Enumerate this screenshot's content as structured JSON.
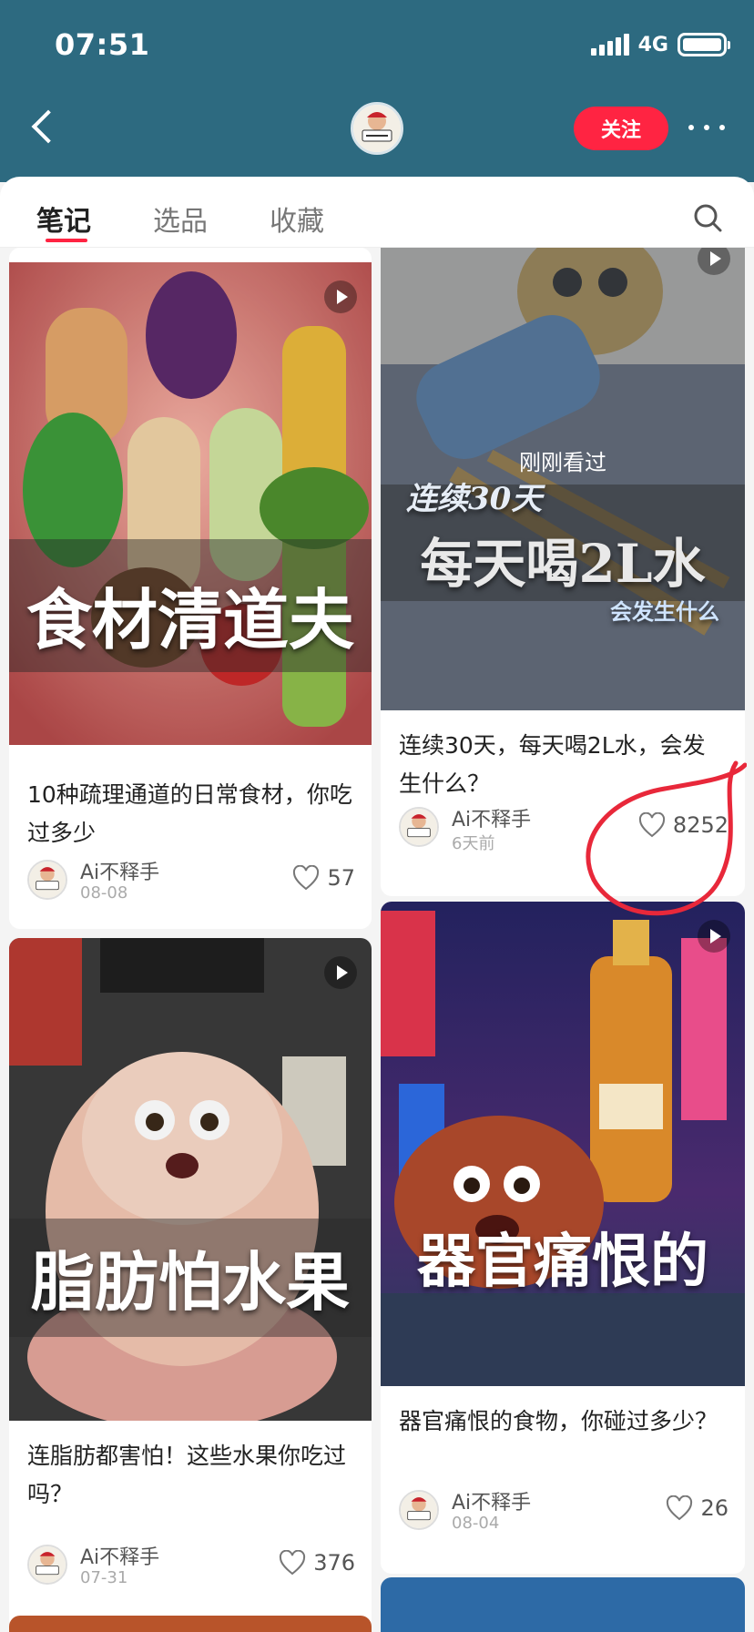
{
  "status": {
    "time": "07:51",
    "network": "4G"
  },
  "header": {
    "follow_label": "关注"
  },
  "tabs": [
    {
      "label": "笔记",
      "active": true
    },
    {
      "label": "选品",
      "active": false
    },
    {
      "label": "收藏",
      "active": false
    }
  ],
  "notes": [
    {
      "overlay": "食材清道夫",
      "title": "10种疏理通道的日常食材，你吃过多少",
      "author": "Ai不释手",
      "date": "08-08",
      "likes": "57"
    },
    {
      "overlay_top": "连续30天",
      "overlay_main": "每天喝2L水",
      "overlay_bottom": "会发生什么",
      "seen_label": "刚刚看过",
      "title": "连续30天，每天喝2L水，会发生什么？",
      "author": "Ai不释手",
      "date": "6天前",
      "likes": "8252"
    },
    {
      "overlay": "脂肪怕水果",
      "title": "连脂肪都害怕！这些水果你吃过吗？",
      "author": "Ai不释手",
      "date": "07-31",
      "likes": "376"
    },
    {
      "overlay": "器官痛恨的",
      "title": "器官痛恨的食物，你碰过多少？",
      "author": "Ai不释手",
      "date": "08-04",
      "likes": "26"
    }
  ],
  "colors": {
    "header_bg": "#2d6a80",
    "accent": "#ff2442",
    "annotation": "#e8283a"
  }
}
